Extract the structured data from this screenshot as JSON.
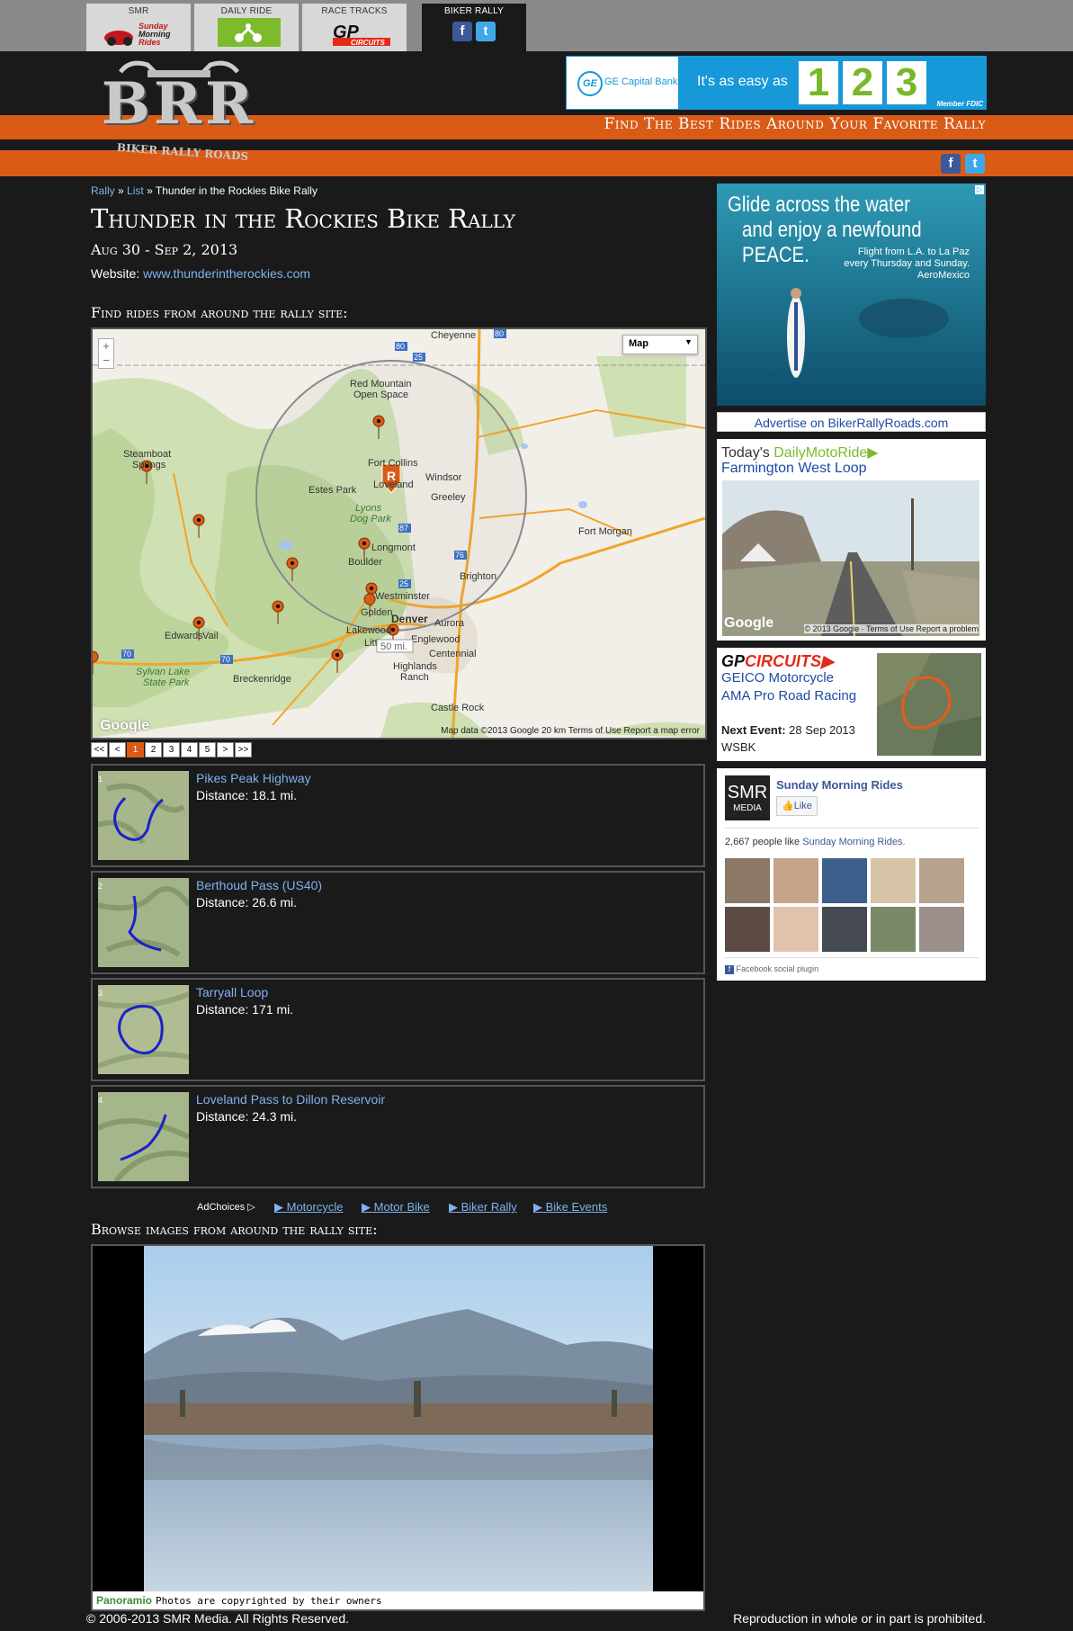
{
  "topnav": {
    "tabs": [
      {
        "label": "SMR",
        "logo": "Sunday Morning Rides"
      },
      {
        "label": "DAILY RIDE",
        "logo": ""
      },
      {
        "label": "RACE TRACKS",
        "logo": "GP CIRCUITS"
      },
      {
        "label": "BIKER RALLY",
        "logo": ""
      }
    ]
  },
  "header": {
    "logo_text": "BRR",
    "logo_sub": "BIKER RALLY ROADS",
    "tagline": "Find The Best Rides Around Your Favorite Rally",
    "ge_ad": {
      "bank": "GE Capital Bank",
      "text": "It's as easy as",
      "nums": [
        "1",
        "2",
        "3"
      ],
      "member": "Member FDIC"
    },
    "social": {
      "facebook": "f",
      "twitter": "t"
    }
  },
  "breadcrumb": {
    "rally": "Rally",
    "sep": "»",
    "list": "List",
    "current": "Thunder in the Rockies Bike Rally"
  },
  "rally": {
    "title": "Thunder in the Rockies Bike Rally",
    "dates": "Aug 30 - Sep 2, 2013",
    "website_label": "Website:",
    "website_url": "www.thunderintherockies.com"
  },
  "map": {
    "heading": "Find rides from around the rally site:",
    "type_label": "Map",
    "zoom_in": "+",
    "zoom_out": "−",
    "radius_label": "50 mi.",
    "footer": "Map data ©2013 Google   20 km   Terms of Use   Report a map error",
    "google": "Google",
    "places": [
      "Cheyenne",
      "Red Mountain Open Space",
      "Steamboat Springs",
      "Estes Park",
      "Fort Collins",
      "Loveland",
      "Windsor",
      "Greeley",
      "Lyons Dog Park",
      "Longmont",
      "Boulder",
      "Brighton",
      "Westminster",
      "Golden",
      "Denver",
      "Aurora",
      "Lakewood",
      "Littleton",
      "Englewood",
      "Centennial",
      "Highlands Ranch",
      "Castle Rock",
      "Edwards",
      "Vail",
      "Breckenridge",
      "Sylvan Lake State Park",
      "Fort Morgan"
    ]
  },
  "pager": {
    "items": [
      "<<",
      "<",
      "1",
      "2",
      "3",
      "4",
      "5",
      ">",
      ">>"
    ]
  },
  "rides": [
    {
      "num": "1",
      "name": "Pikes Peak Highway",
      "distance": "Distance: 18.1 mi."
    },
    {
      "num": "2",
      "name": "Berthoud Pass (US40)",
      "distance": "Distance: 26.6 mi."
    },
    {
      "num": "3",
      "name": "Tarryall Loop",
      "distance": "Distance: 171 mi."
    },
    {
      "num": "4",
      "name": "Loveland Pass to Dillon Reservoir",
      "distance": "Distance: 24.3 mi."
    }
  ],
  "adlinks": {
    "adchoices": "AdChoices",
    "links": [
      "Motorcycle",
      "Motor Bike",
      "Biker Rally",
      "Bike Events"
    ]
  },
  "photos": {
    "heading": "Browse images from around the rally site:",
    "brand": "Panoramio",
    "copyright": "Photos are copyrighted by their owners"
  },
  "sidebar": {
    "aero_ad": {
      "headline1": "Glide across the water",
      "headline2": "and enjoy a newfound PEACE.",
      "sub1": "Flight from L.A. to La Paz",
      "sub2": "every Thursday and Sunday.",
      "brand": "AeroMexico"
    },
    "advertise": "Advertise on BikerRallyRoads.com",
    "daily_ride": {
      "prefix": "Today's",
      "brand": "DailyMotoRide",
      "title": "Farmington West Loop",
      "credit": "© 2013 Google · Terms of Use   Report a problem",
      "google": "Google"
    },
    "gp": {
      "brand_gp": "GP",
      "brand_circuits": "CIRCUITS",
      "title": "GEICO Motorcycle AMA Pro Road Racing",
      "next_label": "Next Event:",
      "next_date": "28 Sep 2013",
      "series": "WSBK"
    },
    "facebook": {
      "page_name": "Sunday Morning Rides",
      "logo_top": "SMR",
      "logo_bottom": "MEDIA",
      "like": "Like",
      "count_text": "2,667 people like",
      "count_link": "Sunday Morning Rides.",
      "plugin": "Facebook social plugin"
    }
  },
  "footer": {
    "copyright": "© 2006-2013 SMR Media. All Rights Reserved.",
    "notice": "Reproduction in whole or in part is prohibited."
  },
  "colors": {
    "accent_orange": "#d95b16",
    "link_blue": "#7fb2ee",
    "bg": "#1a1a1a"
  }
}
